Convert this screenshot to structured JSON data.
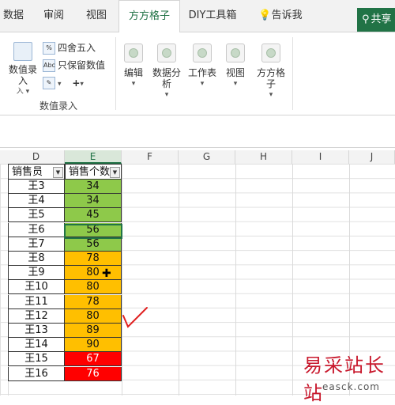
{
  "ribbon_tabs": [
    "数据",
    "审阅",
    "视图",
    "方方格子",
    "DIY工具箱",
    "告诉我"
  ],
  "active_tab": "方方格子",
  "share_label": "共享",
  "ribbon": {
    "data_entry_label": "数值录入",
    "round_label": "四舍五入",
    "keep_values_label": "只保留数值",
    "edit_label": "编辑",
    "data_analysis_label": "数据分析",
    "worksheet_label": "工作表",
    "view_label": "视图",
    "ffgz_label": "方方格子",
    "group_label": "数值录入"
  },
  "columns": [
    "D",
    "E",
    "F",
    "G",
    "H",
    "I",
    "J"
  ],
  "selected_column": "E",
  "table": {
    "header_name": "销售员",
    "header_value": "销售个数",
    "rows": [
      {
        "name": "王3",
        "value": "34"
      },
      {
        "name": "王4",
        "value": "34"
      },
      {
        "name": "王5",
        "value": "45"
      },
      {
        "name": "王6",
        "value": "56"
      },
      {
        "name": "王7",
        "value": "56"
      },
      {
        "name": "王8",
        "value": "78"
      },
      {
        "name": "王9",
        "value": "80"
      },
      {
        "name": "王10",
        "value": "80"
      },
      {
        "name": "王11",
        "value": "78"
      },
      {
        "name": "王12",
        "value": "80"
      },
      {
        "name": "王13",
        "value": "89"
      },
      {
        "name": "王14",
        "value": "90"
      },
      {
        "name": "王15",
        "value": "67"
      },
      {
        "name": "王16",
        "value": "76"
      }
    ]
  },
  "colors": {
    "accent": "#217346",
    "green_fill": "#8ec94a",
    "orange_fill": "#ffbf00",
    "red_fill": "#ff0000",
    "red_text": "#ffffff"
  },
  "watermark": {
    "text": "易采站长站",
    "url": "easck.com"
  }
}
